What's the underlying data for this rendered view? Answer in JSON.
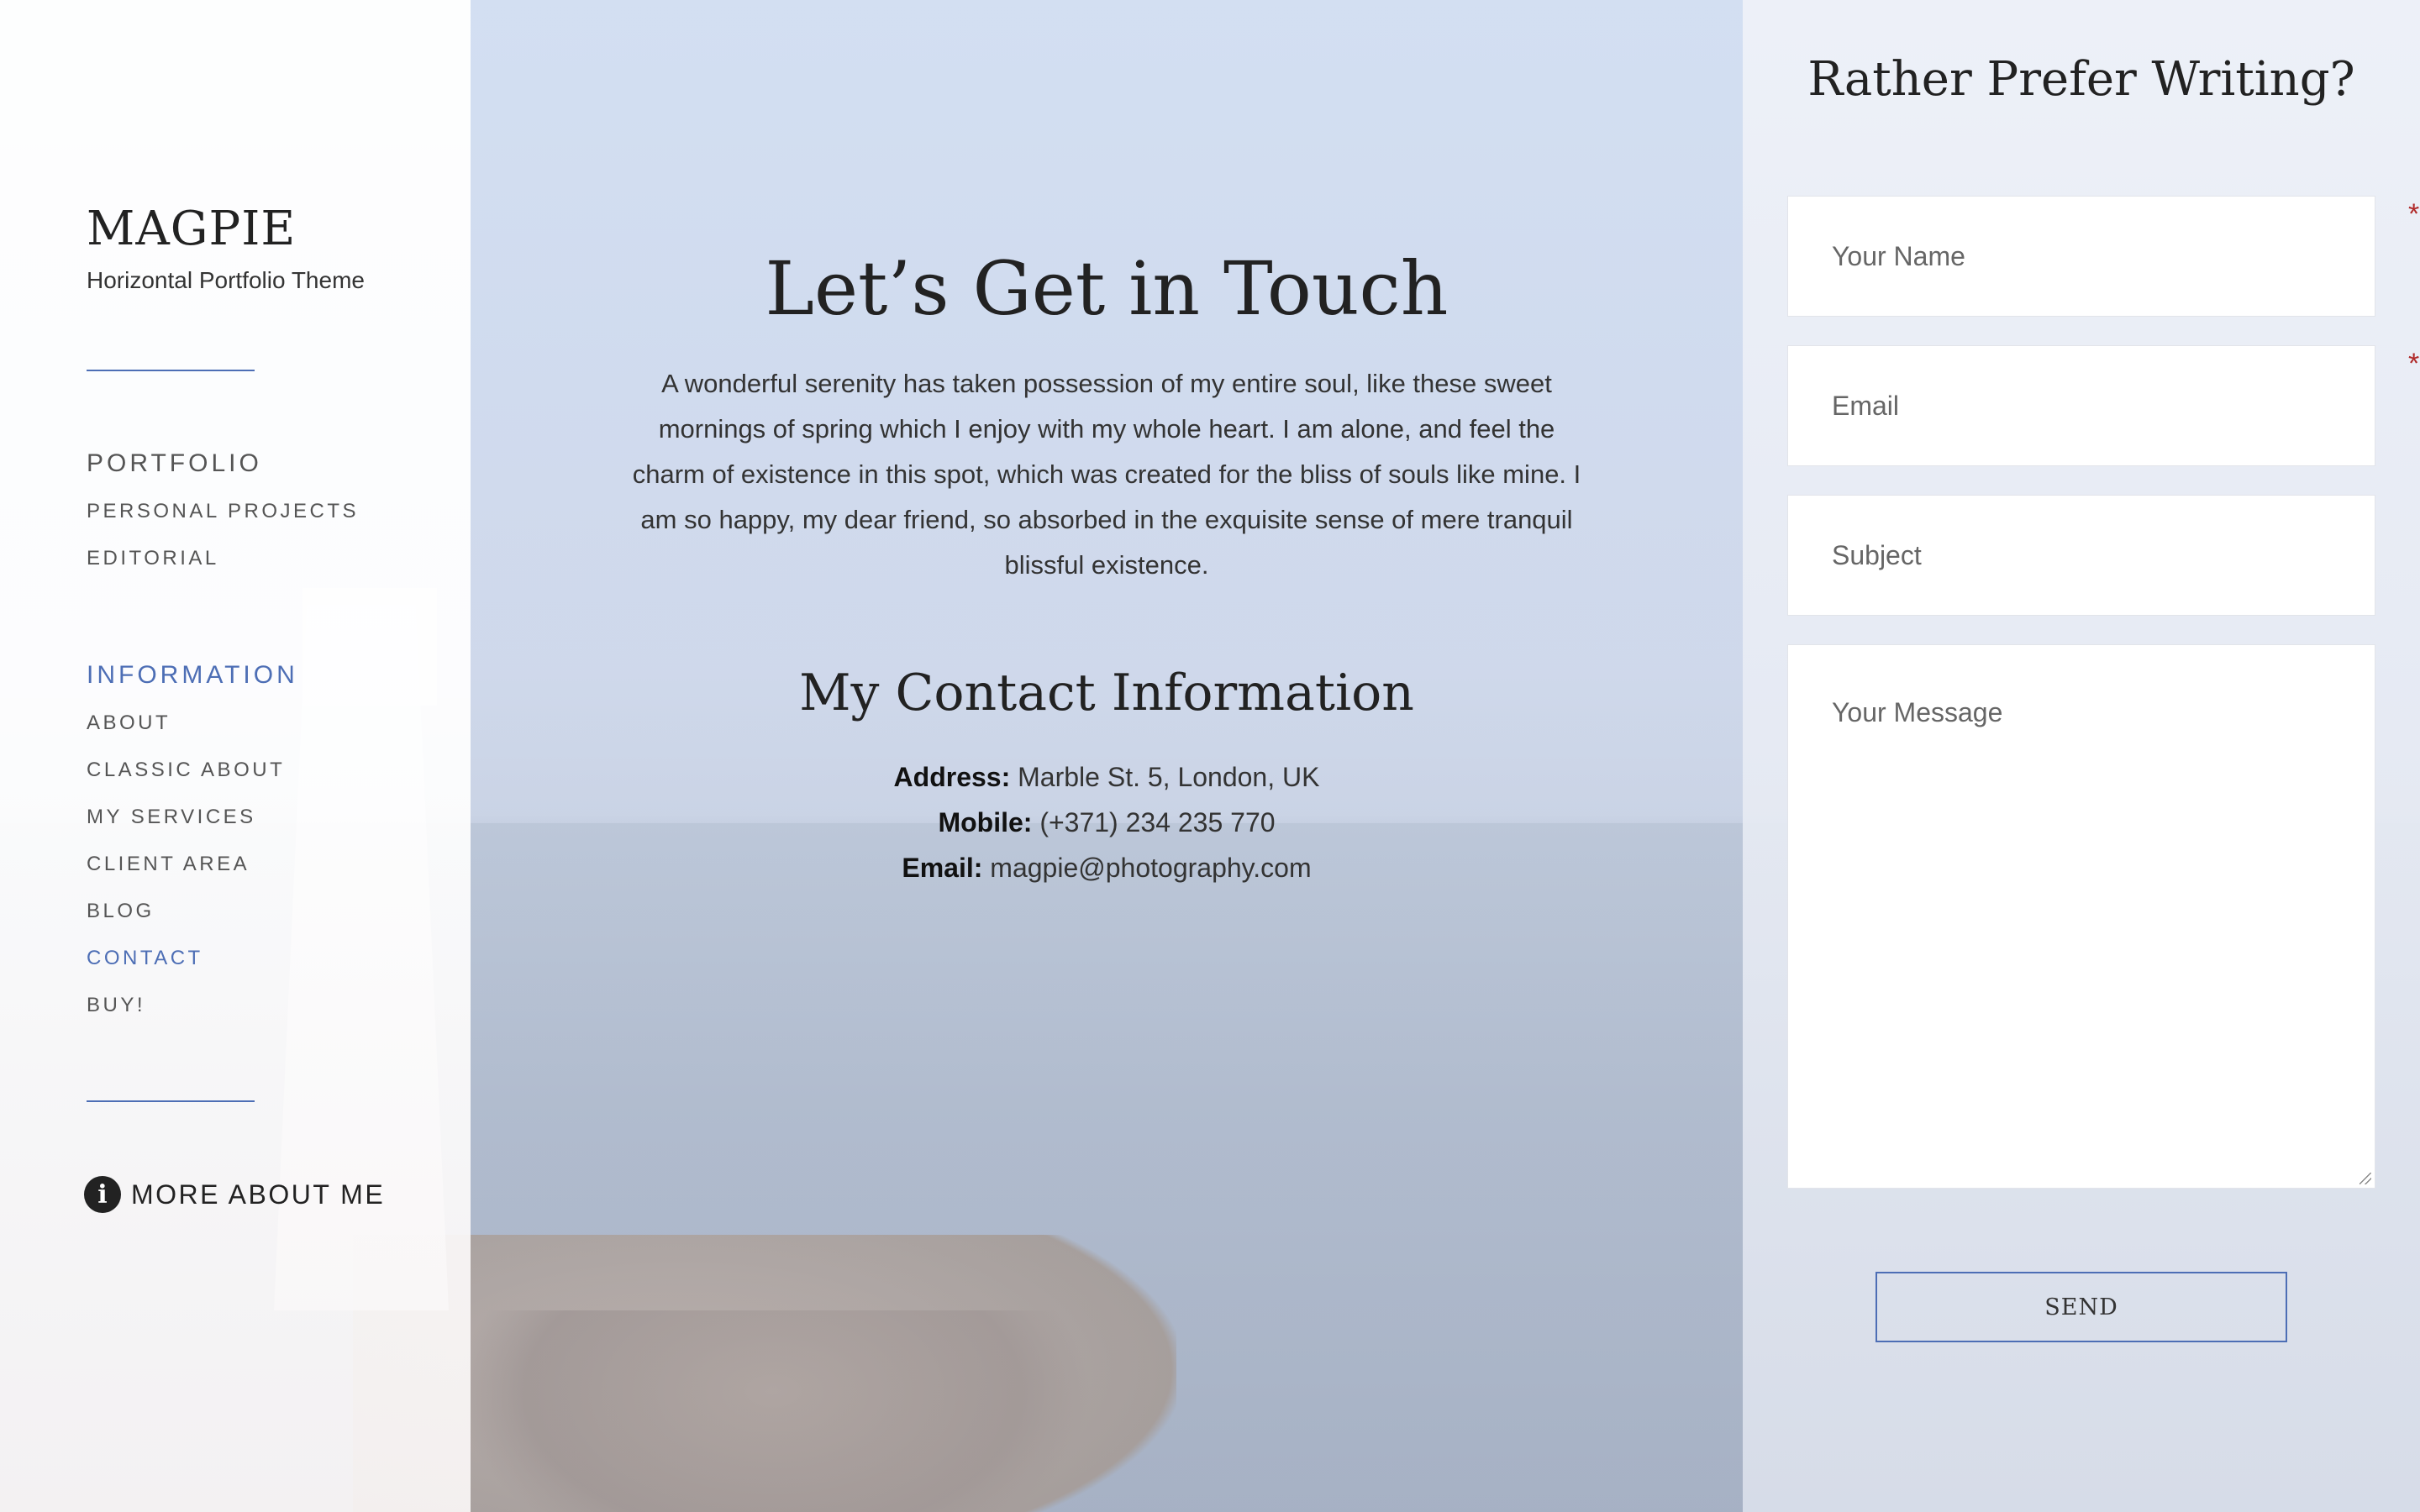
{
  "sidebar": {
    "brand": "MAGPIE",
    "tagline": "Horizontal Portfolio Theme",
    "nav": [
      {
        "label": "PORTFOLIO",
        "type": "heading",
        "active": false
      },
      {
        "label": "PERSONAL PROJECTS",
        "type": "item",
        "active": false
      },
      {
        "label": "EDITORIAL",
        "type": "item",
        "active": false
      },
      {
        "label": "INFORMATION",
        "type": "heading",
        "active": true
      },
      {
        "label": "ABOUT",
        "type": "item",
        "active": false
      },
      {
        "label": "CLASSIC ABOUT",
        "type": "item",
        "active": false
      },
      {
        "label": "MY SERVICES",
        "type": "item",
        "active": false
      },
      {
        "label": "CLIENT AREA",
        "type": "item",
        "active": false
      },
      {
        "label": "BLOG",
        "type": "item",
        "active": false
      },
      {
        "label": "CONTACT",
        "type": "item",
        "active": true
      },
      {
        "label": "BUY!",
        "type": "item",
        "active": false
      }
    ],
    "more_about": {
      "label": "MORE ABOUT ME",
      "icon": "info-icon"
    }
  },
  "main": {
    "title": "Let’s Get in Touch",
    "intro": "A wonderful serenity has taken possession of my entire soul, like these sweet mornings of spring which I enjoy with my whole heart. I am alone, and feel the charm of existence in this spot, which was created for the bliss of souls like mine. I am so happy, my dear friend, so absorbed in the exquisite sense of mere tranquil blissful existence.",
    "contact_title": "My Contact Information",
    "contact": {
      "address_label": "Address:",
      "address": "Marble St. 5, London, UK",
      "mobile_label": "Mobile:",
      "mobile": "(+371) 234 235 770",
      "email_label": "Email:",
      "email": "magpie@photography.com"
    }
  },
  "form": {
    "title": "Rather Prefer Writing?",
    "name_placeholder": "Your Name",
    "email_placeholder": "Email",
    "subject_placeholder": "Subject",
    "message_placeholder": "Your Message",
    "required_mark": "*",
    "send_label": "SEND"
  },
  "colors": {
    "accent": "#4d6eb5",
    "required": "#b02a2a",
    "text": "#222222"
  }
}
